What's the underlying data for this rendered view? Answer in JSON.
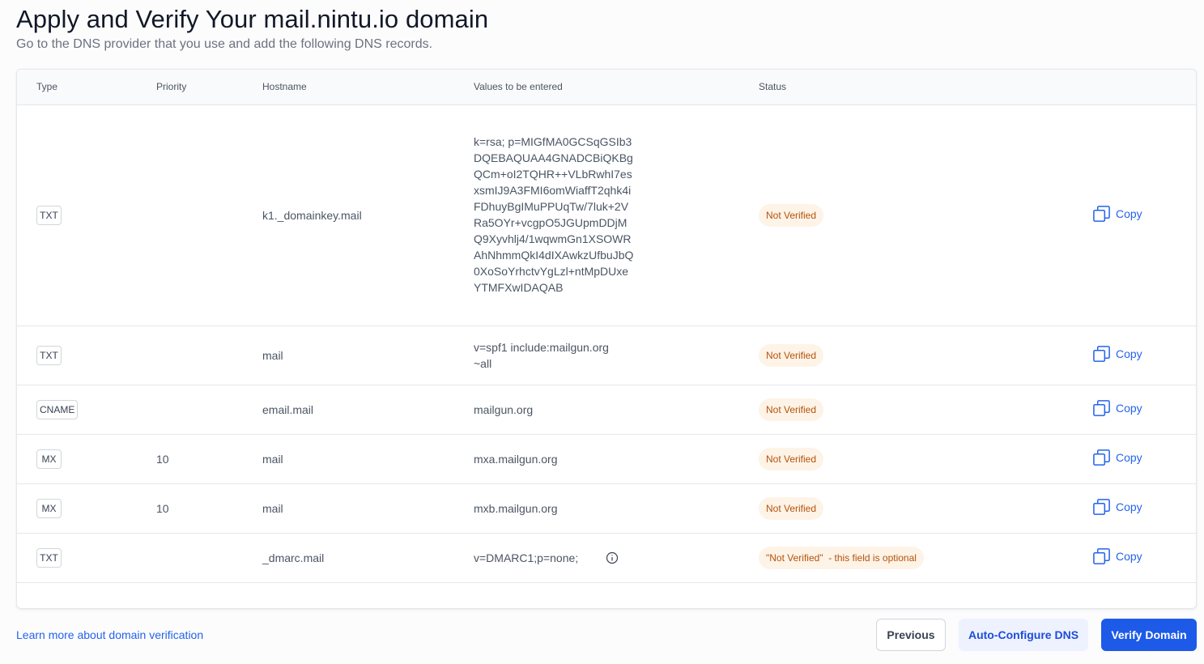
{
  "header": {
    "title": "Apply and Verify Your mail.nintu.io domain",
    "subtitle": "Go to the DNS provider that you use and add the following DNS records."
  },
  "table": {
    "columns": {
      "type": "Type",
      "priority": "Priority",
      "hostname": "Hostname",
      "values": "Values to be entered",
      "status": "Status"
    },
    "rows": [
      {
        "type": "TXT",
        "priority": "",
        "hostname": "k1._domainkey.mail",
        "value": "k=rsa; p=MIGfMA0GCSqGSIb3DQEBAQUAA4GNADCBiQKBgQCm+oI2TQHR++VLbRwhI7esxsmIJ9A3FMI6omWiaffT2qhk4iFDhuyBgIMuPPUqTw/7luk+2VRa5OYr+vcgpO5JGUpmDDjMQ9Xyvhlj4/1wqwmGn1XSOWRAhNhmmQkI4dIXAwkzUfbuJbQ0XoSoYrhctvYgLzl+ntMpDUxeYTMFXwIDAQAB",
        "status": "Not Verified",
        "copy": "Copy"
      },
      {
        "type": "TXT",
        "priority": "",
        "hostname": "mail",
        "value": "v=spf1 include:mailgun.org ~all",
        "status": "Not Verified",
        "copy": "Copy"
      },
      {
        "type": "CNAME",
        "priority": "",
        "hostname": "email.mail",
        "value": "mailgun.org",
        "status": "Not Verified",
        "copy": "Copy"
      },
      {
        "type": "MX",
        "priority": "10",
        "hostname": "mail",
        "value": "mxa.mailgun.org",
        "status": "Not Verified",
        "copy": "Copy"
      },
      {
        "type": "MX",
        "priority": "10",
        "hostname": "mail",
        "value": "mxb.mailgun.org",
        "status": "Not Verified",
        "copy": "Copy"
      },
      {
        "type": "TXT",
        "priority": "",
        "hostname": "_dmarc.mail",
        "value": "v=DMARC1;p=none;",
        "status": "\"Not Verified\"  - this field is optional",
        "copy": "Copy",
        "value_icon": "info-icon"
      }
    ]
  },
  "footer": {
    "learn_more": "Learn more about domain verification",
    "previous": "Previous",
    "auto_configure": "Auto-Configure DNS",
    "verify": "Verify Domain"
  },
  "colors": {
    "accent": "#1d5ae8",
    "link": "#2563eb",
    "status_bg": "#fef3e7",
    "status_text": "#b45309"
  },
  "icons": {
    "copy": "copy-icon",
    "info": "info-icon"
  }
}
